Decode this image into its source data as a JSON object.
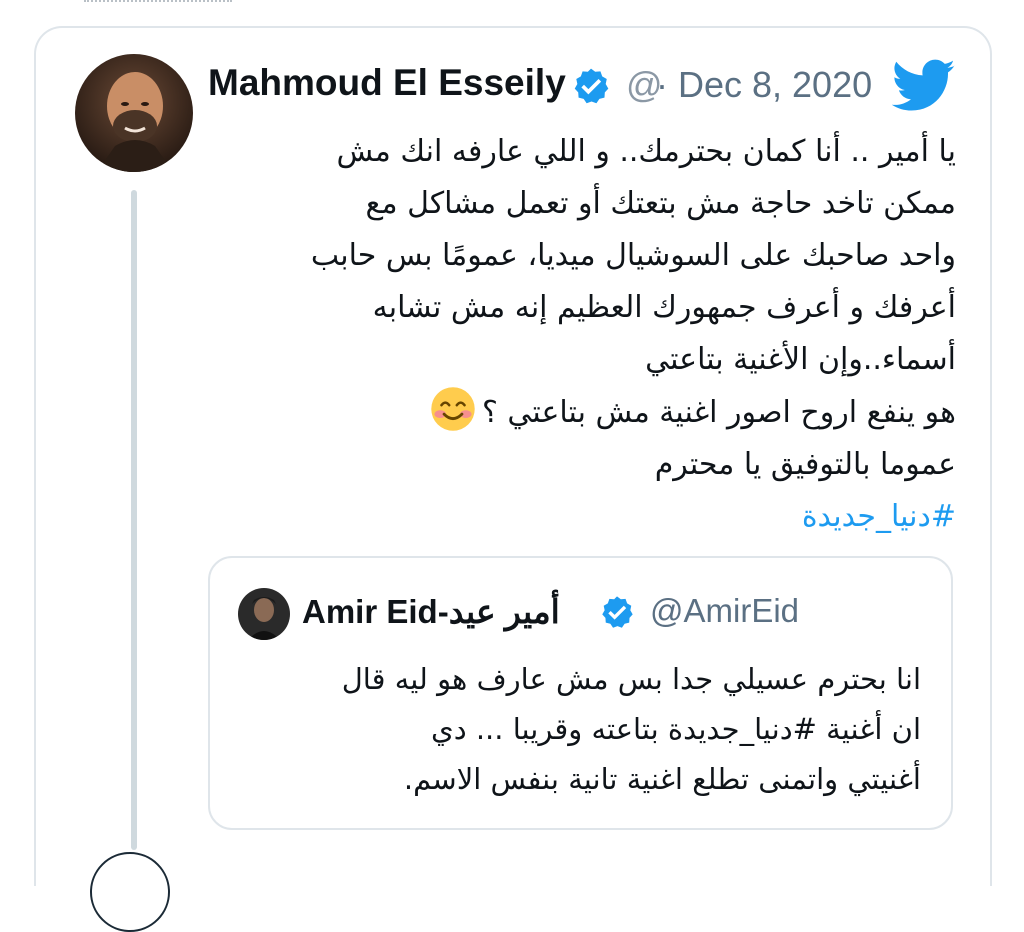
{
  "tweet": {
    "author_name": "Mahmoud El Esseily",
    "handle_fragment": "@",
    "date": "· Dec 8, 2020",
    "body_lines": [
      "يا أمير .. أنا كمان بحترمك.. و اللي عارفه انك مش",
      "ممكن تاخد حاجة مش بتعتك أو تعمل مشاكل  مع",
      "واحد صاحبك على السوشيال ميديا، عمومًا بس حابب",
      "أعرفك و أعرف جمهورك العظيم إنه مش تشابه",
      "أسماء..وإن الأغنية بتاعتي",
      "هو ينفع اروح اصور اغنية مش بتاعتي ؟",
      "عموما بالتوفيق يا محترم"
    ],
    "hashtag": "#دنيا_جديدة",
    "emoji": "smiling-face-icon"
  },
  "quoted_tweet": {
    "author_name": "Amir Eid-أمير عيد",
    "handle": "@AmirEid",
    "body_lines": [
      "انا بحترم عسيلي جدا بس مش عارف هو ليه قال",
      "ان أغنية #دنيا_جديدة بتاعته وقريبا ... دي",
      "أغنيتي واتمنى تطلع اغنية تانية بنفس الاسم."
    ]
  },
  "colors": {
    "accent": "#1d9bf0",
    "border": "#dfe5ea",
    "muted_text": "#5b7083",
    "verified": "#1d9bf0"
  }
}
